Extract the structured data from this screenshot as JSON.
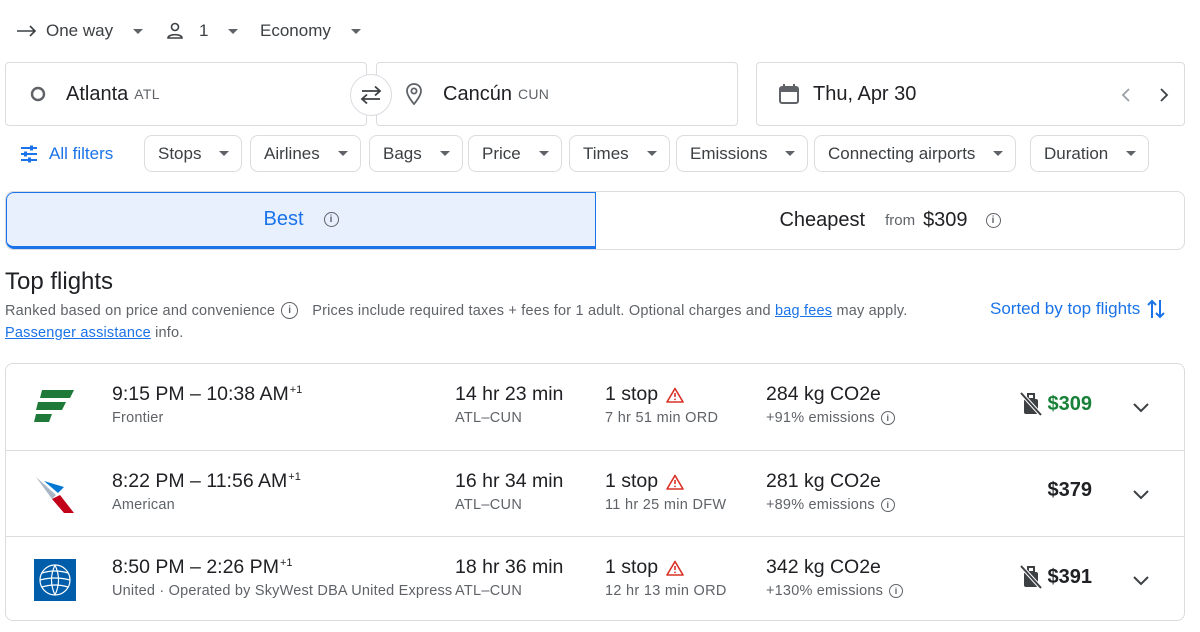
{
  "trip_options": {
    "trip_type": "One way",
    "passengers": "1",
    "cabin_class": "Economy"
  },
  "search": {
    "origin_city": "Atlanta",
    "origin_code": "ATL",
    "destination_city": "Cancún",
    "destination_code": "CUN",
    "date": "Thu, Apr 30"
  },
  "filters": {
    "all_filters_label": "All filters",
    "chips": [
      "Stops",
      "Airlines",
      "Bags",
      "Price",
      "Times",
      "Emissions",
      "Connecting airports",
      "Duration"
    ]
  },
  "tabs": {
    "best_label": "Best",
    "cheapest_label": "Cheapest",
    "cheapest_from": "from",
    "cheapest_price": "$309"
  },
  "results": {
    "title": "Top flights",
    "ranked_text": "Ranked based on price and convenience",
    "prices_text": "Prices include required taxes + fees for 1 adult. Optional charges and",
    "bag_fees_link": "bag fees",
    "may_apply": "may apply.",
    "passenger_assistance_link": "Passenger assistance",
    "info_text": "info.",
    "sorted_label": "Sorted by top flights"
  },
  "flights": [
    {
      "departure": "9:15 PM",
      "arrival": "10:38 AM",
      "day_offset": "+1",
      "airline": "Frontier",
      "duration": "14 hr 23 min",
      "route": "ATL–CUN",
      "stops": "1 stop",
      "layover": "7 hr 51 min ORD",
      "co2": "284 kg CO2e",
      "emissions": "+91% emissions",
      "price": "$309",
      "no_carry_on": true,
      "price_color": "#188038"
    },
    {
      "departure": "8:22 PM",
      "arrival": "11:56 AM",
      "day_offset": "+1",
      "airline": "American",
      "duration": "16 hr 34 min",
      "route": "ATL–CUN",
      "stops": "1 stop",
      "layover": "11 hr 25 min DFW",
      "co2": "281 kg CO2e",
      "emissions": "+89% emissions",
      "price": "$379",
      "no_carry_on": false,
      "price_color": "#202124"
    },
    {
      "departure": "8:50 PM",
      "arrival": "2:26 PM",
      "day_offset": "+1",
      "airline": "United · Operated by SkyWest DBA United Express",
      "duration": "18 hr 36 min",
      "route": "ATL–CUN",
      "stops": "1 stop",
      "layover": "12 hr 13 min ORD",
      "co2": "342 kg CO2e",
      "emissions": "+130% emissions",
      "price": "$391",
      "no_carry_on": true,
      "price_color": "#202124"
    }
  ],
  "colors": {
    "accent": "#1a73e8",
    "price_green": "#188038",
    "warning": "#d93025",
    "border": "#dadce0"
  }
}
